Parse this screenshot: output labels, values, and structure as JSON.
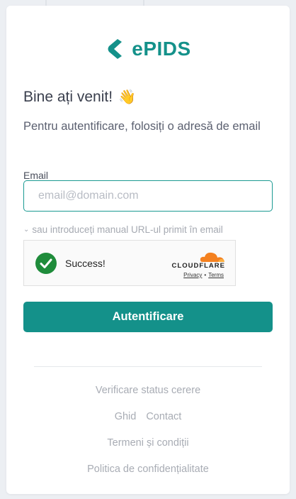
{
  "brand": {
    "name": "ePIDS",
    "color": "#14918a",
    "logo_icon": "chevron-left-logo-icon"
  },
  "welcome": {
    "title": "Bine ați venit!",
    "emoji": "👋"
  },
  "subtitle": "Pentru autentificare, folosiți o adresă de email",
  "email": {
    "label": "Email",
    "placeholder": "email@domain.com",
    "value": ""
  },
  "url_toggle": {
    "label": "sau introduceți manual URL-ul primit în email",
    "icon": "chevron-down-icon"
  },
  "captcha": {
    "status": "Success!",
    "status_icon": "check-circle-icon",
    "brand": "CLOUDFLARE",
    "privacy": "Privacy",
    "separator": "•",
    "terms": "Terms"
  },
  "submit": {
    "label": "Autentificare"
  },
  "footer": {
    "status_link": "Verificare status cerere",
    "guide": "Ghid",
    "contact": "Contact",
    "terms": "Termeni și condiții",
    "privacy": "Politica de confidențialitate"
  }
}
